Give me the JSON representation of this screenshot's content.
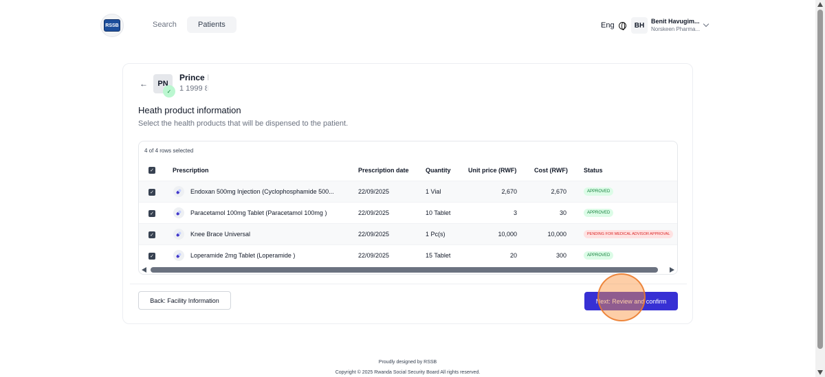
{
  "header": {
    "logo_text": "RSSB",
    "nav": [
      {
        "label": "Search"
      },
      {
        "label": "Patients"
      }
    ],
    "language": "Eng",
    "user": {
      "initials": "BH",
      "name": "Benit Havugim...",
      "org": "Norskeen Pharma..."
    }
  },
  "patient": {
    "initials": "PN",
    "name": "Prince I",
    "id": "1 1999 8"
  },
  "section": {
    "title": "Heath product information",
    "subtitle": "Select the health products that will be dispensed to the patient."
  },
  "table": {
    "selection_summary": "4 of 4 rows selected",
    "columns": [
      "Prescription",
      "Prescription date",
      "Quantity",
      "Unit price (RWF)",
      "Cost (RWF)",
      "Status"
    ],
    "rows": [
      {
        "prescription": "Endoxan 500mg Injection (Cyclophosphamide 500...",
        "date": "22/09/2025",
        "quantity": "1 Vial",
        "unit_price": "2,670",
        "cost": "2,670",
        "status": "APPROVED",
        "checked": true
      },
      {
        "prescription": "Paracetamol 100mg Tablet (Paracetamol 100mg )",
        "date": "22/09/2025",
        "quantity": "10 Tablet",
        "unit_price": "3",
        "cost": "30",
        "status": "APPROVED",
        "checked": true
      },
      {
        "prescription": "Knee Brace Universal",
        "date": "22/09/2025",
        "quantity": "1 Pc(s)",
        "unit_price": "10,000",
        "cost": "10,000",
        "status": "PENDING FOR MEDICAL ADVISOR APPROVAL",
        "checked": true
      },
      {
        "prescription": "Loperamide 2mg Tablet (Loperamide )",
        "date": "22/09/2025",
        "quantity": "15 Tablet",
        "unit_price": "20",
        "cost": "300",
        "status": "APPROVED",
        "checked": true
      }
    ]
  },
  "actions": {
    "back_label": "Back: Facility Information",
    "next_label": "Next: Review and confirm"
  },
  "footer": {
    "line1": "Proudly designed by RSSB",
    "line2": "Copyright © 2025 Rwanda Social Security Board All rights reserved."
  },
  "colors": {
    "primary": "#3730d4",
    "approved_bg": "#dcfce7",
    "approved_text": "#15803d",
    "pending_bg": "#fee2e2",
    "pending_text": "#dc2626",
    "click_indicator": "#fb923c"
  },
  "icons": [
    "back-arrow-icon",
    "globe-icon",
    "chevron-down-icon",
    "verified-check-icon",
    "pill-icon",
    "checkbox-checked-icon"
  ]
}
